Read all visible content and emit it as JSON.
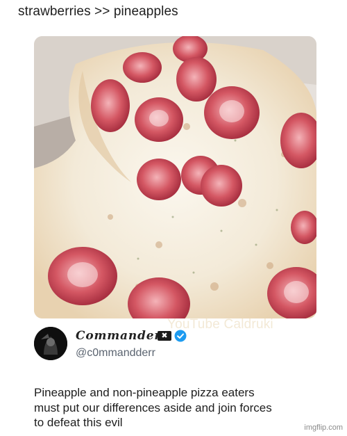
{
  "caption": "strawberries >> pineapples",
  "photo": {
    "description_icon": "strawberry-pizza-photo",
    "watermark": "YouTube Caldruki"
  },
  "author": {
    "display_name": "Commander",
    "flag_icon": "flag-icon",
    "flag_glyph": "✖",
    "verified_icon": "verified-badge-icon",
    "verified_color": "#1d9bf0",
    "handle": "@c0mmandderr"
  },
  "tweet": {
    "lines": [
      "Pineapple and non-pineapple pizza eaters",
      "must put our differences aside and join forces",
      "to defeat this evil"
    ]
  },
  "source_watermark": "imgflip.com"
}
